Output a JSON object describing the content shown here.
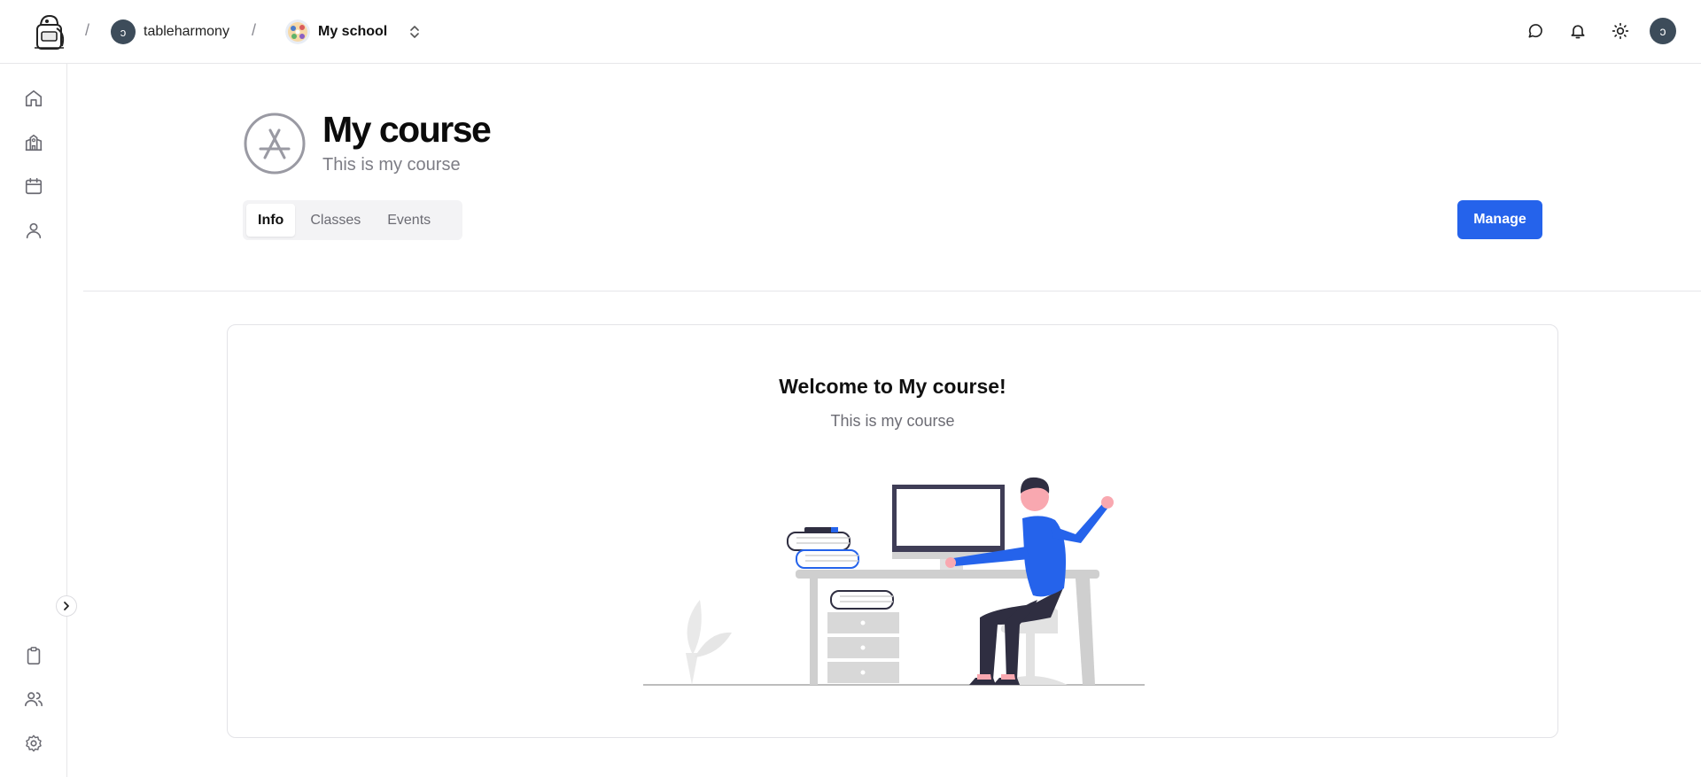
{
  "topbar": {
    "logo_icon": "backpack-logo-icon",
    "separator": "/",
    "user": {
      "name": "tableharmony",
      "initial": "ɔ"
    },
    "school": {
      "name": "My school"
    },
    "actions": [
      "chat-icon",
      "bell-icon",
      "sun-icon",
      "user-avatar"
    ],
    "avatar_initial": "ɔ"
  },
  "sidebar": {
    "top_items": [
      "home-icon",
      "school-icon",
      "calendar-icon",
      "user-icon"
    ],
    "bottom_items": [
      "clipboard-icon",
      "users-icon",
      "settings-icon"
    ],
    "collapse_icon": "chevron-right-icon"
  },
  "course": {
    "title": "My course",
    "subtitle": "This is my course",
    "tabs": [
      {
        "label": "Info",
        "active": true
      },
      {
        "label": "Classes",
        "active": false
      },
      {
        "label": "Events",
        "active": false
      }
    ],
    "manage_label": "Manage"
  },
  "welcome": {
    "title": "Welcome to My course!",
    "subtitle": "This is my course",
    "illustration": "person-at-desk-illustration"
  },
  "colors": {
    "accent": "#2563eb",
    "avatar_bg": "#3d4c5a",
    "muted_text": "#7d7d85",
    "border": "#e3e3e7"
  }
}
